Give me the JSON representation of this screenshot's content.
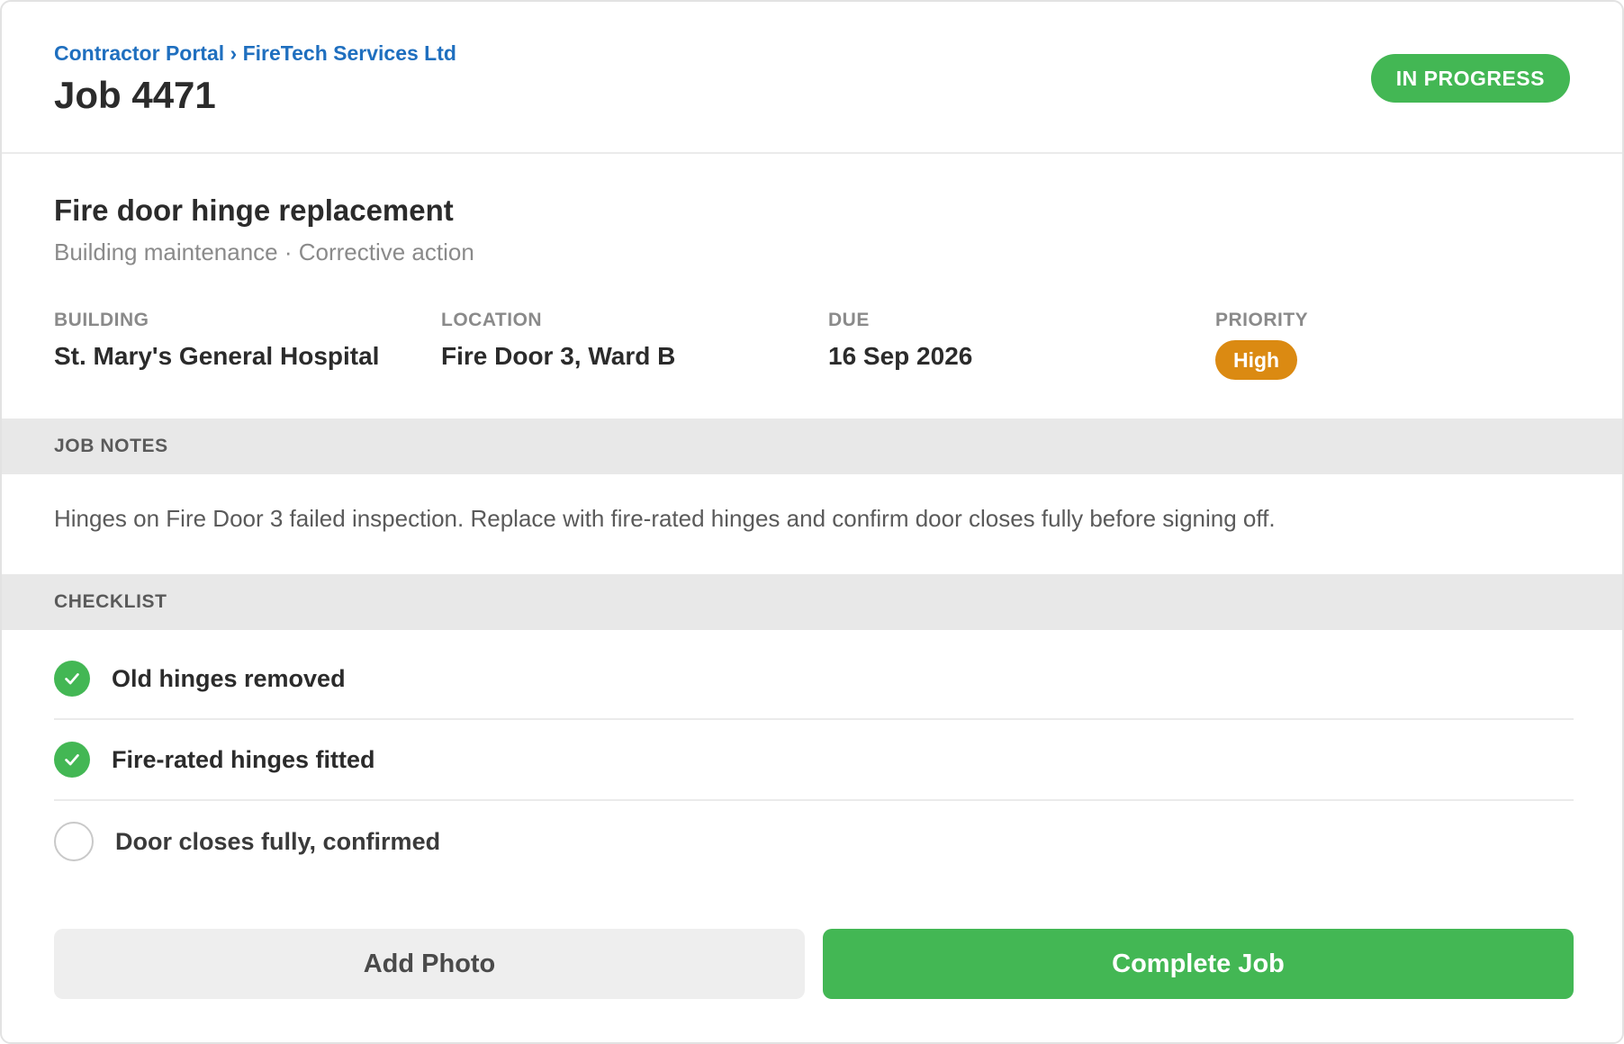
{
  "header": {
    "breadcrumb_root": "Contractor Portal",
    "breadcrumb_sep": " › ",
    "breadcrumb_company": "FireTech Services Ltd",
    "job_title": "Job 4471",
    "status": "IN PROGRESS",
    "status_color": "#43b754"
  },
  "task": {
    "title": "Fire door hinge replacement",
    "subtitle": "Building maintenance · Corrective action"
  },
  "meta": {
    "building_label": "BUILDING",
    "building_value": "St. Mary's General Hospital",
    "location_label": "LOCATION",
    "location_value": "Fire Door 3, Ward B",
    "due_label": "DUE",
    "due_value": "16 Sep 2026",
    "priority_label": "PRIORITY",
    "priority_value": "High",
    "priority_color": "#db8a12"
  },
  "notes": {
    "heading": "JOB NOTES",
    "text": "Hinges on Fire Door 3 failed inspection. Replace with fire-rated hinges and confirm door closes fully before signing off."
  },
  "checklist": {
    "heading": "CHECKLIST",
    "items": [
      {
        "label": "Old hinges removed",
        "done": true,
        "icon": "check-icon"
      },
      {
        "label": "Fire-rated hinges fitted",
        "done": true,
        "icon": "check-icon"
      },
      {
        "label": "Door closes fully, confirmed",
        "done": false,
        "icon": "empty-circle-icon"
      }
    ]
  },
  "actions": {
    "add_photo": "Add Photo",
    "complete_job": "Complete Job",
    "primary_color": "#43b754"
  }
}
